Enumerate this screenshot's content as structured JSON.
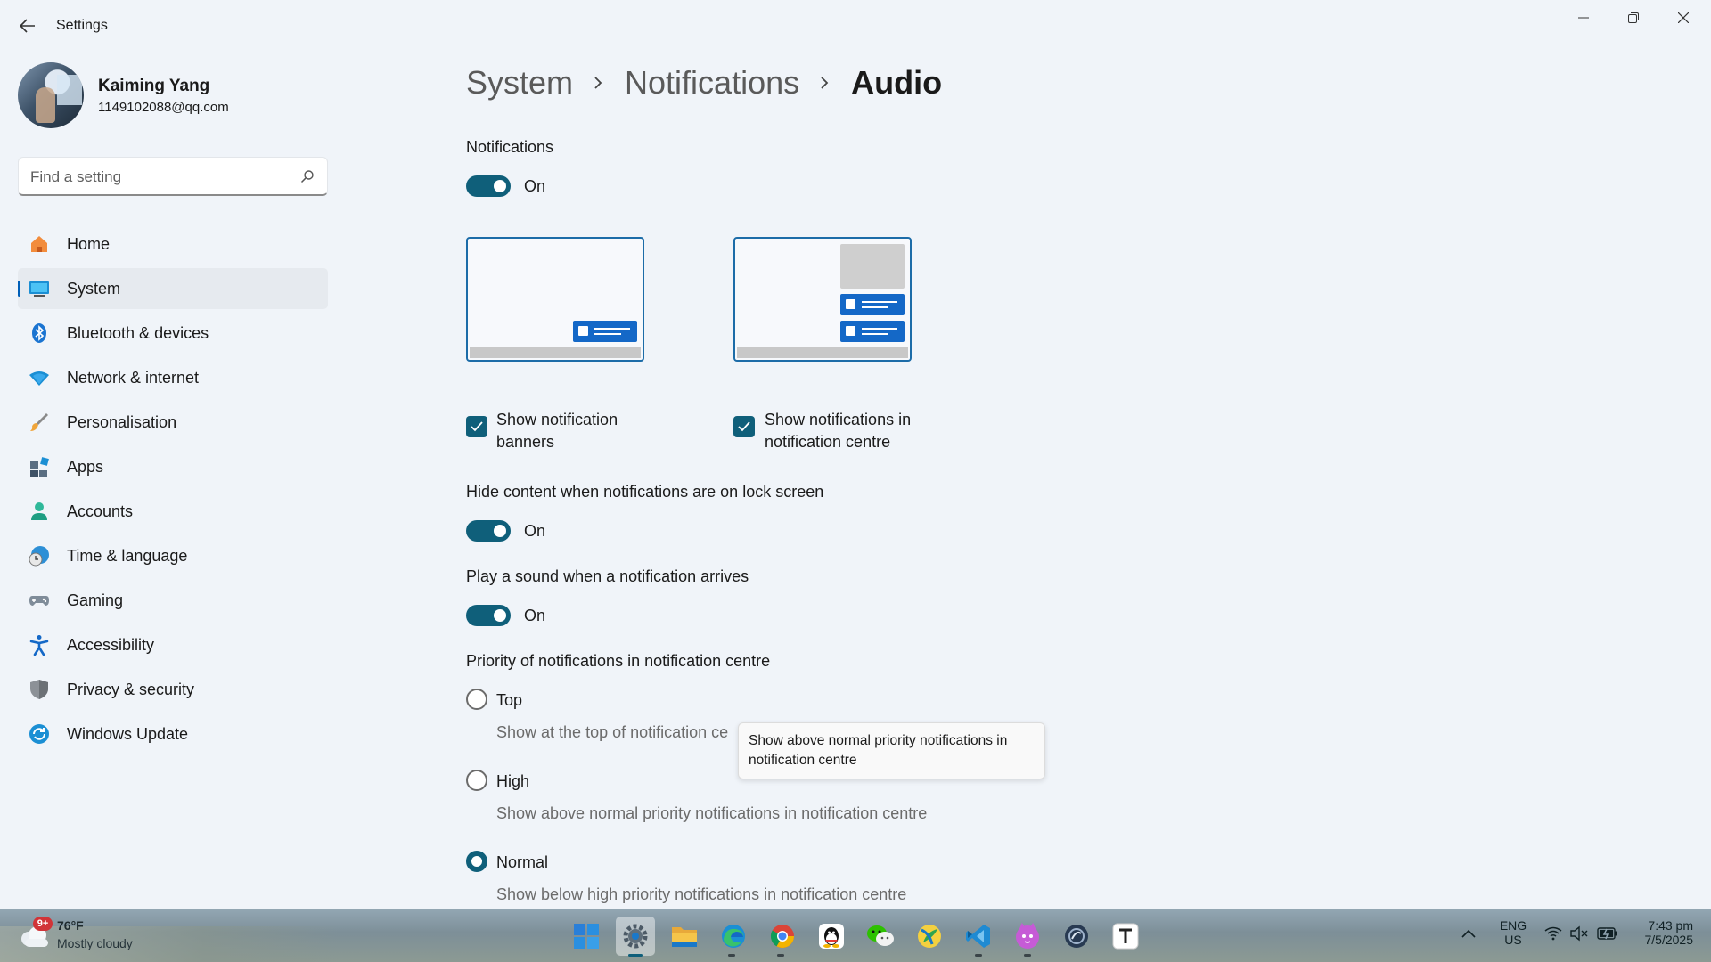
{
  "window": {
    "title": "Settings"
  },
  "profile": {
    "name": "Kaiming Yang",
    "email": "1149102088@qq.com"
  },
  "search": {
    "placeholder": "Find a setting"
  },
  "nav": {
    "items": [
      {
        "label": "Home",
        "icon": "home-icon"
      },
      {
        "label": "System",
        "icon": "monitor-icon",
        "active": true
      },
      {
        "label": "Bluetooth & devices",
        "icon": "bluetooth-icon"
      },
      {
        "label": "Network & internet",
        "icon": "wifi-icon"
      },
      {
        "label": "Personalisation",
        "icon": "brush-icon"
      },
      {
        "label": "Apps",
        "icon": "apps-icon"
      },
      {
        "label": "Accounts",
        "icon": "person-icon"
      },
      {
        "label": "Time & language",
        "icon": "globe-clock-icon"
      },
      {
        "label": "Gaming",
        "icon": "gamepad-icon"
      },
      {
        "label": "Accessibility",
        "icon": "accessibility-icon"
      },
      {
        "label": "Privacy & security",
        "icon": "shield-icon"
      },
      {
        "label": "Windows Update",
        "icon": "update-icon"
      }
    ]
  },
  "breadcrumb": {
    "items": [
      "System",
      "Notifications",
      "Audio"
    ]
  },
  "settings": {
    "notifications": {
      "label": "Notifications",
      "state": "On"
    },
    "show_banners": {
      "label_line1": "Show notification",
      "label_line2": "banners",
      "checked": true
    },
    "show_in_centre": {
      "label_line1": "Show notifications in",
      "label_line2": "notification centre",
      "checked": true
    },
    "hide_content": {
      "label": "Hide content when notifications are on lock screen",
      "state": "On"
    },
    "play_sound": {
      "label": "Play a sound when a notification arrives",
      "state": "On"
    },
    "priority": {
      "label": "Priority of notifications in notification centre",
      "options": [
        {
          "label": "Top",
          "desc": "Show at the top of notification ce",
          "selected": false
        },
        {
          "label": "High",
          "desc": "Show above normal priority notifications in notification centre",
          "selected": false
        },
        {
          "label": "Normal",
          "desc": "Show below high priority notifications in notification centre",
          "selected": true
        }
      ]
    }
  },
  "tooltip": {
    "line1": "Show above normal priority notifications in",
    "line2": "notification centre"
  },
  "taskbar": {
    "weather": {
      "badge": "9+",
      "temp": "76°F",
      "desc": "Mostly cloudy"
    },
    "apps": [
      "windows-start-icon",
      "settings-icon",
      "file-explorer-icon",
      "edge-icon",
      "chrome-icon",
      "qq-icon",
      "wechat-icon",
      "app-icon",
      "vscode-icon",
      "cat-app-icon",
      "app-circle-icon",
      "typora-icon"
    ],
    "language": {
      "line1": "ENG",
      "line2": "US"
    },
    "clock": {
      "time": "7:43 pm",
      "date": "7/5/2025"
    }
  },
  "colors": {
    "accent": "#0f5f7a",
    "background": "#f0f4f9",
    "preview_blue": "#1468c7"
  }
}
